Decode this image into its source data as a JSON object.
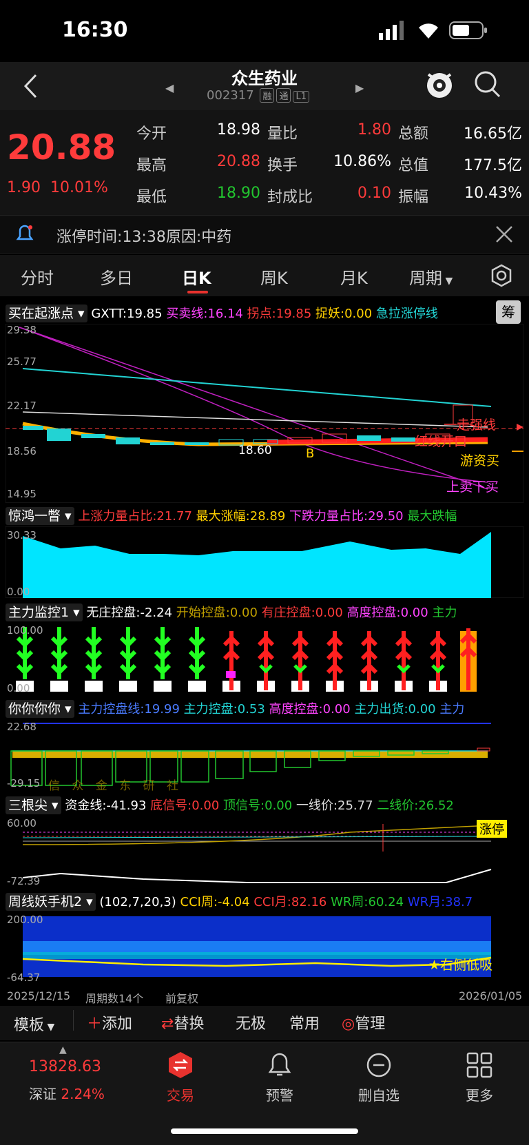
{
  "status": {
    "time": "16:30"
  },
  "header": {
    "name": "众生药业",
    "code": "002317",
    "tags": [
      "融",
      "通",
      "L1"
    ]
  },
  "quote": {
    "price": "20.88",
    "change": "1.90",
    "pct": "10.01%",
    "rows": [
      [
        "今开",
        "18.98",
        "量比",
        "1.80",
        "总额",
        "16.65亿"
      ],
      [
        "最高",
        "20.88",
        "换手",
        "10.86%",
        "总值",
        "177.5亿"
      ],
      [
        "最低",
        "18.90",
        "封成比",
        "0.10",
        "振幅",
        "10.43%"
      ]
    ]
  },
  "limit": {
    "text": "涨停时间:13:38原因:中药"
  },
  "tabs": [
    "分时",
    "多日",
    "日K",
    "周K",
    "月K",
    "周期"
  ],
  "active_tab": "日K",
  "p1": {
    "sel": "买在起涨点",
    "f1": "GXTT:19.85",
    "f2": "买卖线:16.14",
    "f3": "拐点:19.85",
    "f4": "捉妖:0.00",
    "f5": "急拉涨停线",
    "btn": "筹",
    "ticks": [
      "29.38",
      "25.77",
      "22.17",
      "18.56",
      "14.95"
    ],
    "labels": [
      "一走强线",
      "红线开口",
      "游资买",
      "上卖下买",
      "18.60",
      "B"
    ]
  },
  "p2": {
    "sel": "惊鸿一瞥",
    "f1": "上涨力量占比:21.77",
    "f2": "最大涨幅:28.89",
    "f3": "下跌力量占比:29.50",
    "f4": "最大跌幅",
    "ticks": [
      "30.33",
      "0.00"
    ]
  },
  "p3": {
    "sel": "主力监控1",
    "f1": "无庄控盘:-2.24",
    "f2": "开始控盘:0.00",
    "f3": "有庄控盘:0.00",
    "f4": "高度控盘:0.00",
    "f5": "主力",
    "ticks": [
      "100.00",
      "0.00"
    ]
  },
  "p4": {
    "sel": "你你你你",
    "f1": "主力控盘线:19.99",
    "f2": "主力控盘:0.53",
    "f3": "高度控盘:0.00",
    "f4": "主力出货:0.00",
    "f5": "主力",
    "ticks": [
      "22.68",
      "-29.15"
    ],
    "wm": "信 众 金 东 研 社"
  },
  "p5": {
    "sel": "三根尖",
    "f1": "资金线:-41.93",
    "f2": "底信号:0.00",
    "f3": "顶信号:0.00",
    "f4": "一线价:25.77",
    "f5": "二线价:26.52",
    "ticks": [
      "60.00",
      "-72.39"
    ],
    "badge": "涨停"
  },
  "p6": {
    "sel": "周线妖手机2",
    "f1": "(102,7,20,3)",
    "f2": "CCI周:-4.04",
    "f3": "CCI月:82.16",
    "f4": "WR周:60.24",
    "f5": "WR月:38.7",
    "ticks": [
      "200.00",
      "-64.37"
    ],
    "label": "★右侧低吸"
  },
  "footer": {
    "start": "2025/12/15",
    "weeks": "周期数14个",
    "adj": "前复权",
    "end": "2026/01/05"
  },
  "toolbar": [
    "模板",
    "添加",
    "替换",
    "无极",
    "常用",
    "管理"
  ],
  "bottom": {
    "index_val": "13828.63",
    "index_name": "深证",
    "index_pct": "2.24%",
    "items": [
      "交易",
      "预警",
      "删自选",
      "更多"
    ]
  },
  "colors": {
    "up": "#ff3b3b",
    "down": "#22c52f",
    "accent": "#e8322e"
  }
}
